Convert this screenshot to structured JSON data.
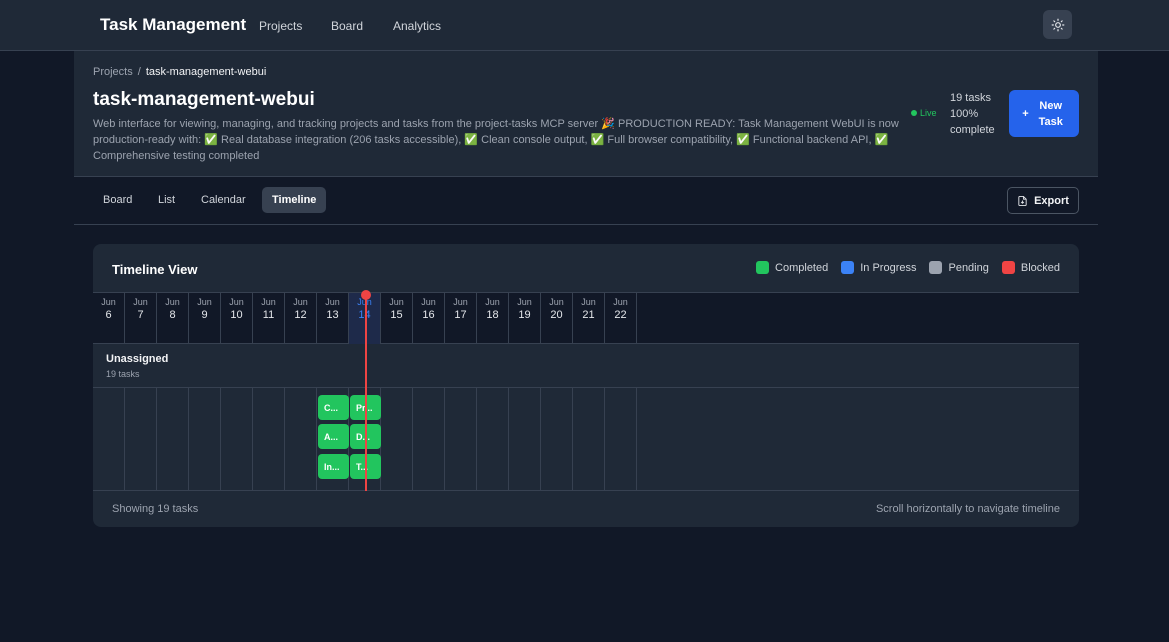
{
  "app": {
    "brand": "Task Management",
    "nav": [
      "Projects",
      "Board",
      "Analytics"
    ]
  },
  "breadcrumb": {
    "root": "Projects",
    "separator": "/",
    "current": "task-management-webui"
  },
  "project": {
    "title": "task-management-webui",
    "description": "Web interface for viewing, managing, and tracking projects and tasks from the project-tasks MCP server 🎉 PRODUCTION READY: Task Management WebUI is now production-ready with: ✅ Real database integration (206 tasks accessible), ✅ Clean console output, ✅ Full browser compatibility, ✅ Functional backend API, ✅ Comprehensive testing completed",
    "status": "Live",
    "task_count": "19 tasks",
    "completion": "100%",
    "completion_label": "complete",
    "new_task_icon": "+",
    "new_task_line1": "New",
    "new_task_line2": "Task"
  },
  "tabs": [
    {
      "label": "Board",
      "active": false
    },
    {
      "label": "List",
      "active": false
    },
    {
      "label": "Calendar",
      "active": false
    },
    {
      "label": "Timeline",
      "active": true
    }
  ],
  "export_label": "Export",
  "timeline": {
    "title": "Timeline View",
    "legend": [
      {
        "label": "Completed",
        "color": "#22c55e"
      },
      {
        "label": "In Progress",
        "color": "#3b82f6"
      },
      {
        "label": "Pending",
        "color": "#9ca3af"
      },
      {
        "label": "Blocked",
        "color": "#ef4444"
      }
    ],
    "month": "Jun",
    "days": [
      "6",
      "7",
      "8",
      "9",
      "10",
      "11",
      "12",
      "13",
      "14",
      "15",
      "16",
      "17",
      "18",
      "19",
      "20",
      "21",
      "22"
    ],
    "today": "14",
    "group": {
      "name": "Unassigned",
      "count": "19 tasks"
    },
    "tasks": [
      {
        "label": "C...",
        "day": "13",
        "status": "Completed"
      },
      {
        "label": "Pr...",
        "day": "14",
        "status": "Completed"
      },
      {
        "label": "A...",
        "day": "13",
        "status": "Completed"
      },
      {
        "label": "D...",
        "day": "14",
        "status": "Completed"
      },
      {
        "label": "In...",
        "day": "13",
        "status": "Completed"
      },
      {
        "label": "T...",
        "day": "14",
        "status": "Completed"
      }
    ],
    "footer_left": "Showing 19 tasks",
    "footer_right": "Scroll horizontally to navigate timeline"
  },
  "colors": {
    "accent": "#2563eb",
    "completed": "#22c55e",
    "today_marker": "#ef4444"
  }
}
